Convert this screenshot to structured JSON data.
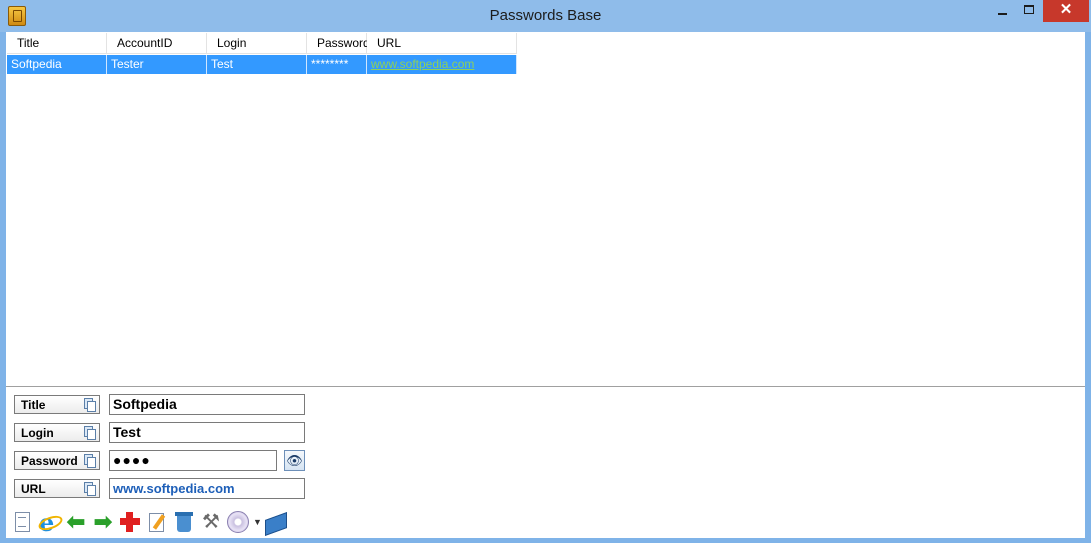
{
  "window": {
    "title": "Passwords Base",
    "min_glyph": "",
    "close_glyph": "✕"
  },
  "list": {
    "columns": [
      "Title",
      "AccountID",
      "Login",
      "Password",
      "URL"
    ],
    "rows": [
      {
        "title": "Softpedia",
        "account_id": "Tester",
        "login": "Test",
        "password": "********",
        "url": "www.softpedia.com"
      }
    ]
  },
  "form": {
    "title_label": "Title",
    "title_value": "Softpedia",
    "login_label": "Login",
    "login_value": "Test",
    "password_label": "Password",
    "password_value": "●●●●",
    "url_label": "URL",
    "url_value": "www.softpedia.com"
  },
  "toolbar": {
    "arrow_back": "⬅",
    "arrow_forward": "➡",
    "tools_glyph": "⚒",
    "dropdown_glyph": "▼",
    "icons": [
      "new-document-icon",
      "internet-explorer-icon",
      "back-arrow-icon",
      "forward-arrow-icon",
      "add-icon",
      "edit-icon",
      "delete-icon",
      "tools-icon",
      "disc-icon",
      "dropdown-icon",
      "book-icon"
    ]
  },
  "colors": {
    "selection": "#3399ff",
    "close_button": "#c7382b",
    "titlebar": "#8fbcea",
    "url_link": "#8dd05a"
  }
}
